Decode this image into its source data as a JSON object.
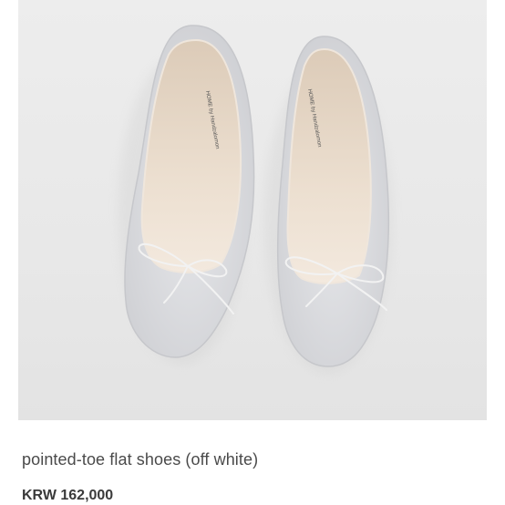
{
  "product": {
    "title": "pointed-toe flat shoes (off white)",
    "price": "KRW 162,000",
    "insole_label": "HOME by Handzalomon",
    "image_alt": "pair of off white pointed-toe flat shoes with bow"
  },
  "colors": {
    "background": "#ffffff",
    "photo_background": "#eaeaea",
    "shoe_body": "#dcdde0",
    "shoe_lining": "#e7d9c9",
    "title_text": "#4a4a4a",
    "price_text": "#3a3a3a"
  },
  "icons": [
    "bow-icon"
  ]
}
